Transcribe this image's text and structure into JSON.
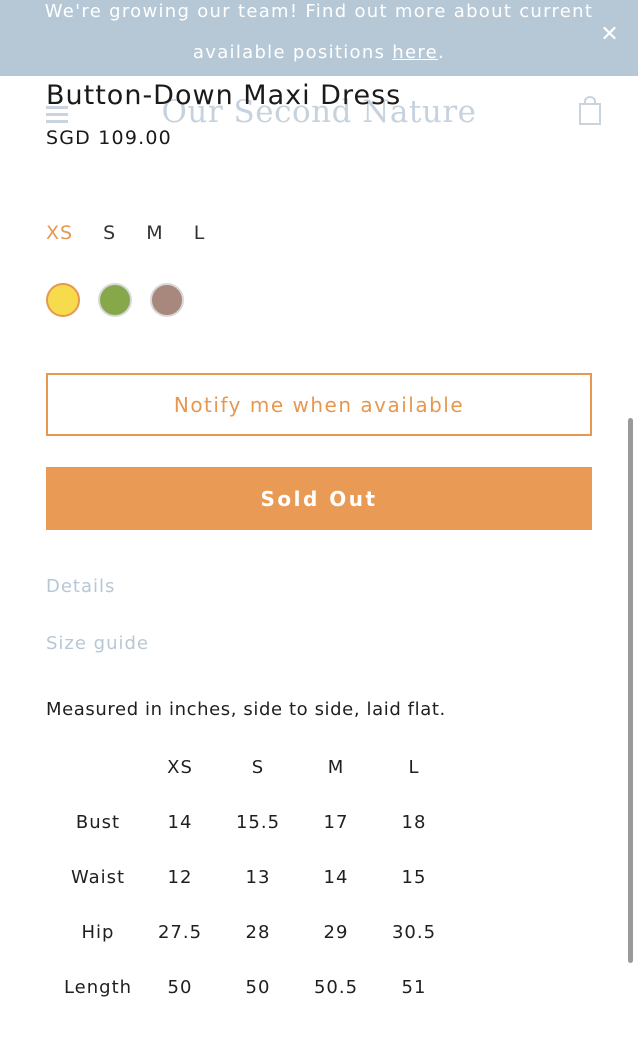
{
  "banner": {
    "text_line1": "We're growing our team! Find out more about current",
    "text_line2_prefix": "available positions ",
    "link_text": "here",
    "text_line2_suffix": ".",
    "close_glyph": "✕",
    "background": "#b6c8d6"
  },
  "header": {
    "brand": "Our Second Nature",
    "menu_icon": "hamburger-menu-icon",
    "cart_icon": "shopping-bag-icon"
  },
  "product": {
    "title": "Button-Down Maxi Dress",
    "price": "SGD 109.00",
    "sizes": [
      "XS",
      "S",
      "M",
      "L"
    ],
    "selected_size": "XS",
    "colors": [
      {
        "name": "yellow",
        "hex": "#f6dc4d"
      },
      {
        "name": "green",
        "hex": "#87a84a"
      },
      {
        "name": "taupe",
        "hex": "#a8877d"
      }
    ],
    "selected_color": "yellow",
    "accent": "#e8974f"
  },
  "actions": {
    "notify_label": "Notify me when available",
    "soldout_label": "Sold Out"
  },
  "links": {
    "details": "Details",
    "size_guide": "Size guide"
  },
  "size_guide": {
    "note": "Measured in inches, side to side, laid flat.",
    "columns": [
      "",
      "XS",
      "S",
      "M",
      "L"
    ],
    "rows": [
      [
        "Bust",
        "14",
        "15.5",
        "17",
        "18"
      ],
      [
        "Waist",
        "12",
        "13",
        "14",
        "15"
      ],
      [
        "Hip",
        "27.5",
        "28",
        "29",
        "30.5"
      ],
      [
        "Length",
        "50",
        "50",
        "50.5",
        "51"
      ]
    ]
  }
}
